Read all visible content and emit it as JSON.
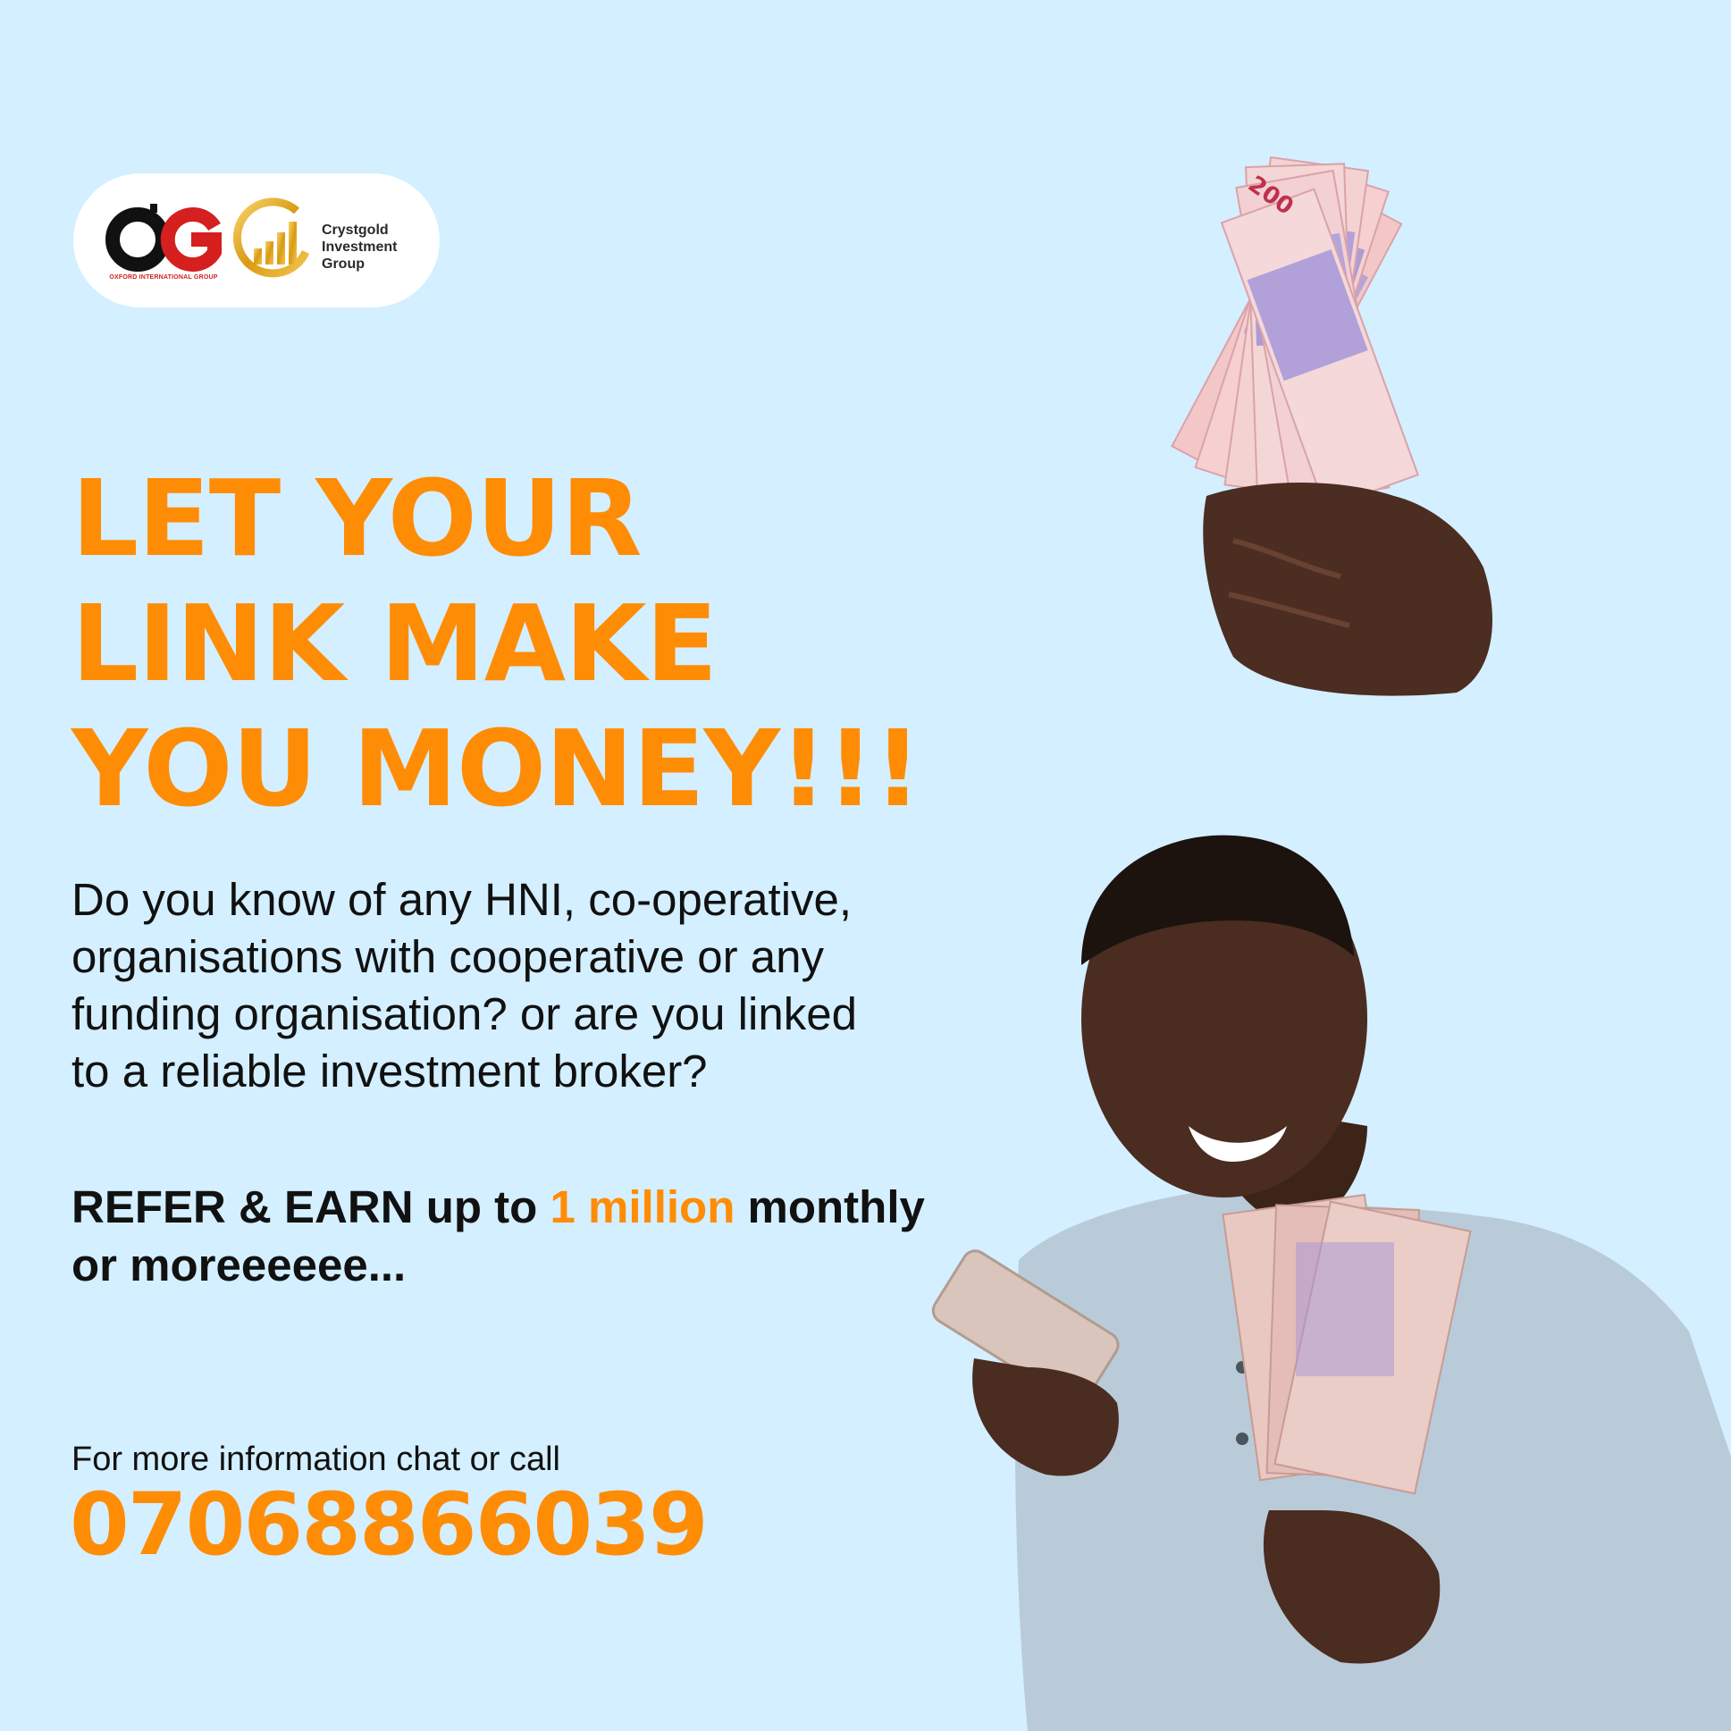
{
  "logos": {
    "og": {
      "letters": "OG",
      "caption": "OXFORD INTERNATIONAL GROUP"
    },
    "crystgold": {
      "line1": "Crystgold",
      "line2": "Investment",
      "line3": "Group"
    }
  },
  "headline": {
    "line1": "LET YOUR",
    "line2": "LINK MAKE",
    "line3": "YOU MONEY!!!"
  },
  "body": {
    "line1": "Do you know of any HNI, co-operative,",
    "line2": "organisations with cooperative or any",
    "line3": "funding organisation? or are you linked",
    "line4": "to a reliable investment broker?"
  },
  "refer": {
    "part1": "REFER & EARN up to ",
    "highlight": "1 million",
    "part2": " monthly",
    "line2": "or moreeeeee..."
  },
  "contact": {
    "label": "For more information chat or call",
    "phone": "07068866039"
  },
  "banknote_denomination": "200",
  "colors": {
    "background": "#d4efff",
    "accent": "#ff8c05",
    "text": "#111111"
  }
}
